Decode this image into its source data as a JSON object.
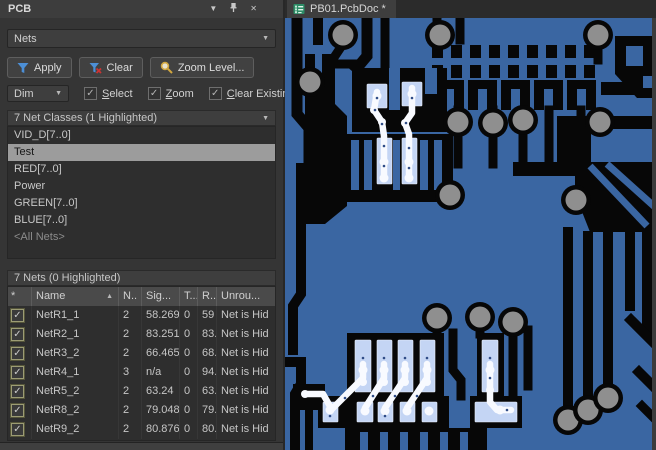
{
  "panel": {
    "title": "PCB",
    "titlebar_icons": [
      "dropdown",
      "pin",
      "close"
    ],
    "mode_selector": {
      "value": "Nets"
    },
    "buttons": {
      "apply": "Apply",
      "clear": "Clear",
      "zoom_level": "Zoom Level..."
    },
    "dim": {
      "value": "Dim",
      "checkboxes": [
        {
          "label": "Select",
          "checked": true
        },
        {
          "label": "Zoom",
          "checked": true
        },
        {
          "label": "Clear Existing",
          "checked": true
        }
      ]
    },
    "classes": {
      "header": "7 Net Classes (1 Highlighted)",
      "items": [
        {
          "label": "VID_D[7..0]",
          "selected": false,
          "muted": false
        },
        {
          "label": "Test",
          "selected": true,
          "muted": false
        },
        {
          "label": "RED[7..0]",
          "selected": false,
          "muted": false
        },
        {
          "label": "Power",
          "selected": false,
          "muted": false
        },
        {
          "label": "GREEN[7..0]",
          "selected": false,
          "muted": false
        },
        {
          "label": "BLUE[7..0]",
          "selected": false,
          "muted": false
        },
        {
          "label": "<All Nets>",
          "selected": false,
          "muted": true
        }
      ]
    },
    "nets": {
      "header": "7 Nets (0 Highlighted)",
      "columns": [
        "*",
        "Name",
        "N..",
        "Sig...",
        "T...",
        "R...",
        "Unrou..."
      ],
      "sort_column": "Name",
      "rows": [
        {
          "checked": true,
          "name": "NetR1_1",
          "nodes": "2",
          "signal": "58.269",
          "t": "0",
          "routed": "59",
          "unrouted": "Net is Hid"
        },
        {
          "checked": true,
          "name": "NetR2_1",
          "nodes": "2",
          "signal": "83.251",
          "t": "0",
          "routed": "83.",
          "unrouted": "Net is Hid"
        },
        {
          "checked": true,
          "name": "NetR3_2",
          "nodes": "2",
          "signal": "66.465",
          "t": "0",
          "routed": "68.",
          "unrouted": "Net is Hid"
        },
        {
          "checked": true,
          "name": "NetR4_1",
          "nodes": "3",
          "signal": "n/a",
          "t": "0",
          "routed": "94.",
          "unrouted": "Net is Hid"
        },
        {
          "checked": true,
          "name": "NetR5_2",
          "nodes": "2",
          "signal": "63.24",
          "t": "0",
          "routed": "63.",
          "unrouted": "Net is Hid"
        },
        {
          "checked": true,
          "name": "NetR8_2",
          "nodes": "2",
          "signal": "79.048",
          "t": "0",
          "routed": "79.",
          "unrouted": "Net is Hid"
        },
        {
          "checked": true,
          "name": "NetR9_2",
          "nodes": "2",
          "signal": "80.876",
          "t": "0",
          "routed": "80.",
          "unrouted": "Net is Hid"
        }
      ]
    }
  },
  "editor": {
    "tab": {
      "label": "PB01.PcbDoc *",
      "icon": "pcb-document-icon",
      "active": true
    }
  },
  "colors": {
    "copper_blue": "#3A66A2",
    "board_black": "#070707",
    "via_gray": "#8F8F8F",
    "highlight_pad": "#C4D5F4",
    "highlight_trace": "#F8FAFF",
    "selection_gray": "#9C9C9C",
    "accent_blue": "#4C8FD6",
    "accent_red": "#CC3333",
    "accent_gold": "#D2A73F"
  }
}
